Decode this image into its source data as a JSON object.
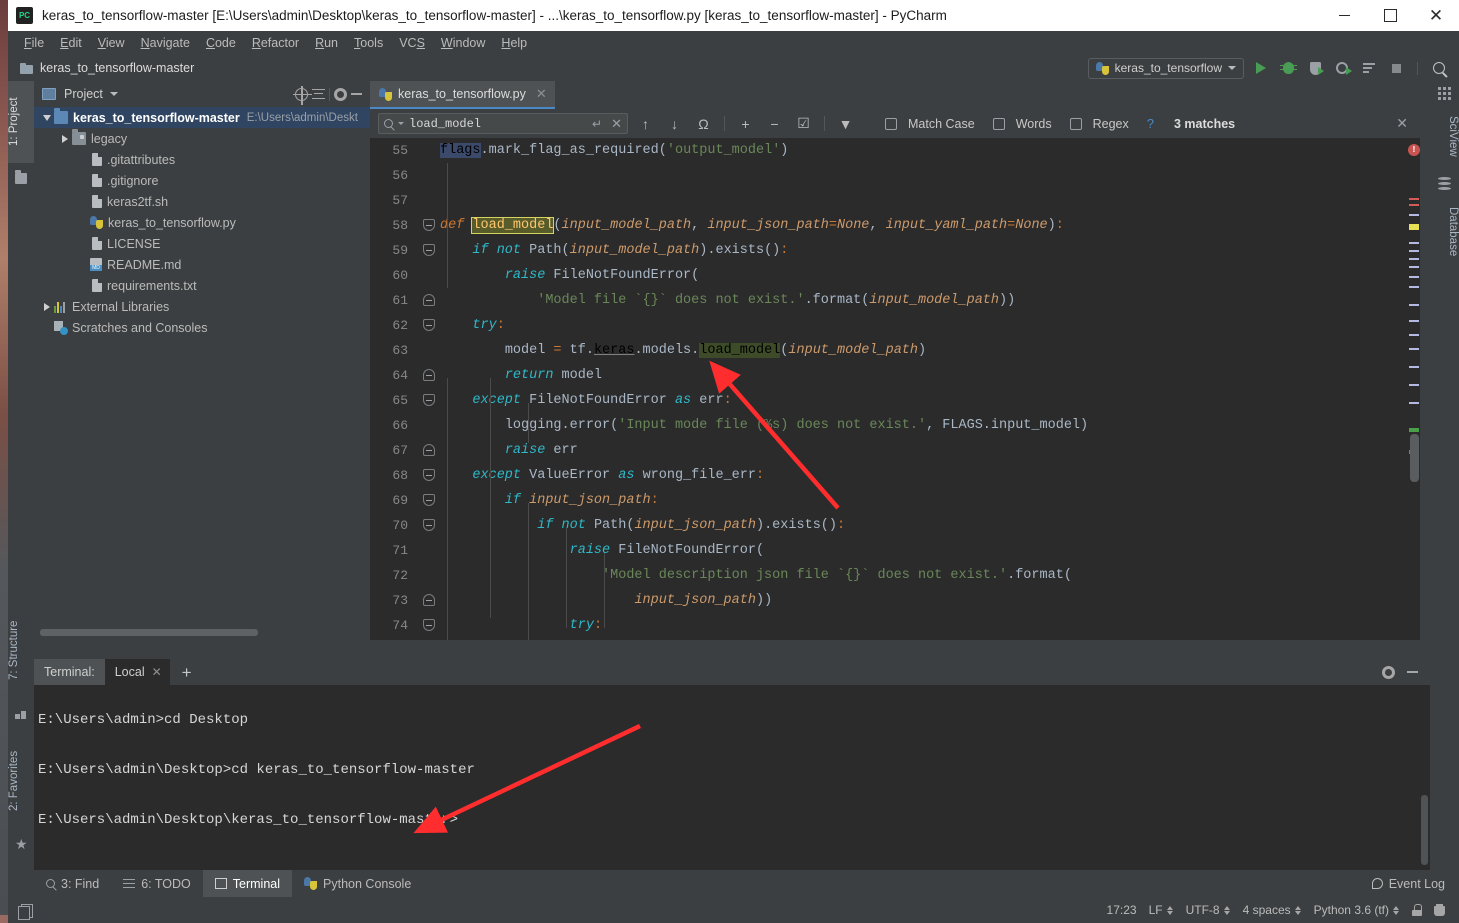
{
  "window": {
    "title": "keras_to_tensorflow-master [E:\\Users\\admin\\Desktop\\keras_to_tensorflow-master] - ...\\keras_to_tensorflow.py [keras_to_tensorflow-master] - PyCharm",
    "app_icon": "pycharm-logo-icon",
    "minimize": "–",
    "maximize": "□",
    "close": "✕"
  },
  "menubar": {
    "items": [
      "File",
      "Edit",
      "View",
      "Navigate",
      "Code",
      "Refactor",
      "Run",
      "Tools",
      "VCS",
      "Window",
      "Help"
    ]
  },
  "navbar": {
    "breadcrumb": "keras_to_tensorflow-master",
    "run_config": "keras_to_tensorflow",
    "buttons": [
      "run-button",
      "debug-button",
      "run-coverage-button",
      "profile-button",
      "run-with-console-button",
      "stop-button",
      "search-everywhere-button"
    ]
  },
  "left_strip": {
    "project_tab": "1: Project",
    "structure_tab": "7: Structure",
    "favorites_tab": "2: Favorites"
  },
  "right_strip": {
    "sciview_tab": "SciView",
    "database_tab": "Database"
  },
  "project_panel": {
    "title": "Project",
    "tree": [
      {
        "label": "keras_to_tensorflow-master",
        "path": "E:\\Users\\admin\\Deskt",
        "icon": "folder-blue-icon",
        "twist": "open",
        "indent": 0,
        "selected": true
      },
      {
        "label": "legacy",
        "path": "",
        "icon": "folder-gray-icon",
        "twist": "closed",
        "indent": 1,
        "selected": false
      },
      {
        "label": ".gitattributes",
        "path": "",
        "icon": "file-icon",
        "twist": "none",
        "indent": 2,
        "selected": false
      },
      {
        "label": ".gitignore",
        "path": "",
        "icon": "file-icon",
        "twist": "none",
        "indent": 2,
        "selected": false
      },
      {
        "label": "keras2tf.sh",
        "path": "",
        "icon": "file-icon",
        "twist": "none",
        "indent": 2,
        "selected": false
      },
      {
        "label": "keras_to_tensorflow.py",
        "path": "",
        "icon": "python-file-icon",
        "twist": "none",
        "indent": 2,
        "selected": false
      },
      {
        "label": "LICENSE",
        "path": "",
        "icon": "file-icon",
        "twist": "none",
        "indent": 2,
        "selected": false
      },
      {
        "label": "README.md",
        "path": "",
        "icon": "markdown-file-icon",
        "twist": "none",
        "indent": 2,
        "selected": false
      },
      {
        "label": "requirements.txt",
        "path": "",
        "icon": "file-icon",
        "twist": "none",
        "indent": 2,
        "selected": false
      },
      {
        "label": "External Libraries",
        "path": "",
        "icon": "library-icon",
        "twist": "closed",
        "indent": 0,
        "selected": false
      },
      {
        "label": "Scratches and Consoles",
        "path": "",
        "icon": "scratches-icon",
        "twist": "none",
        "indent": 0,
        "selected": false
      }
    ]
  },
  "editor": {
    "tab_label": "keras_to_tensorflow.py",
    "tab_close": "✕",
    "find": {
      "value": "load_model",
      "enter_glyph": "↵",
      "clear_glyph": "✕",
      "prev_label": "↑",
      "next_label": "↓",
      "match_case_label": "Match Case",
      "words_label": "Words",
      "regex_label": "Regex",
      "help_label": "?",
      "matches_label": "3 matches",
      "close_label": "✕"
    },
    "first_line_number": 55,
    "lines": [
      {
        "n": 55,
        "fold": "none"
      },
      {
        "n": 56,
        "fold": "none"
      },
      {
        "n": 57,
        "fold": "none"
      },
      {
        "n": 58,
        "fold": "start"
      },
      {
        "n": 59,
        "fold": "start"
      },
      {
        "n": 60,
        "fold": "none"
      },
      {
        "n": 61,
        "fold": "end"
      },
      {
        "n": 62,
        "fold": "start"
      },
      {
        "n": 63,
        "fold": "none"
      },
      {
        "n": 64,
        "fold": "end"
      },
      {
        "n": 65,
        "fold": "start"
      },
      {
        "n": 66,
        "fold": "none"
      },
      {
        "n": 67,
        "fold": "end"
      },
      {
        "n": 68,
        "fold": "start"
      },
      {
        "n": 69,
        "fold": "start"
      },
      {
        "n": 70,
        "fold": "start"
      },
      {
        "n": 71,
        "fold": "none"
      },
      {
        "n": 72,
        "fold": "none"
      },
      {
        "n": 73,
        "fold": "end"
      },
      {
        "n": 74,
        "fold": "start"
      }
    ],
    "source_lines": [
      "flags.mark_flag_as_required('output_model')",
      "",
      "",
      "def load_model(input_model_path, input_json_path=None, input_yaml_path=None):",
      "    if not Path(input_model_path).exists():",
      "        raise FileNotFoundError(",
      "            'Model file `{}` does not exist.'.format(input_model_path))",
      "    try:",
      "        model = tf.keras.models.load_model(input_model_path)",
      "        return model",
      "    except FileNotFoundError as err:",
      "        logging.error('Input mode file (%s) does not exist.', FLAGS.input_model)",
      "        raise err",
      "    except ValueError as wrong_file_err:",
      "        if input_json_path:",
      "            if not Path(input_json_path).exists():",
      "                raise FileNotFoundError(",
      "                    'Model description json file `{}` does not exist.'.format(",
      "                        input_json_path))",
      "            try:"
    ]
  },
  "terminal": {
    "label": "Terminal:",
    "tab": "Local",
    "tab_close": "✕",
    "add_label": "+",
    "lines": [
      "E:\\Users\\admin>cd Desktop",
      "E:\\Users\\admin\\Desktop>cd keras_to_tensorflow-master",
      "E:\\Users\\admin\\Desktop\\keras_to_tensorflow-master>"
    ]
  },
  "bottom_bar": {
    "tabs": [
      {
        "label": "3: Find",
        "underline": "3",
        "icon": "search-icon",
        "active": false
      },
      {
        "label": "6: TODO",
        "underline": "6",
        "icon": "todo-list-icon",
        "active": false
      },
      {
        "label": "Terminal",
        "underline": "",
        "icon": "terminal-icon",
        "active": true
      },
      {
        "label": "Python Console",
        "underline": "",
        "icon": "python-icon",
        "active": false
      }
    ]
  },
  "status_bar": {
    "event_log": "Event Log",
    "time": "17:23",
    "line_sep": "LF",
    "encoding": "UTF-8",
    "indent": "4 spaces",
    "interpreter": "Python 3.6 (tf)"
  },
  "colors": {
    "accent_blue": "#4a88c7",
    "run_green": "#499c54",
    "error_red": "#c75450",
    "editor_bg": "#2b2b2b",
    "panel_bg": "#3c3f41",
    "selection_blue": "#2f4562",
    "annotation_red": "#ff2d2d"
  }
}
